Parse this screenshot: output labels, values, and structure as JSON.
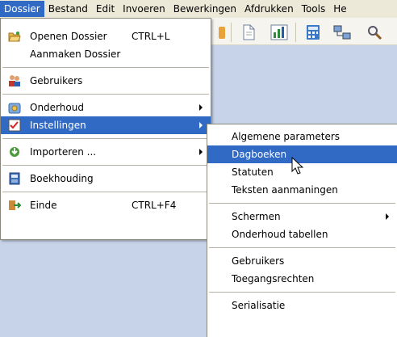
{
  "menubar": {
    "items": [
      "Dossier",
      "Bestand",
      "Edit",
      "Invoeren",
      "Bewerkingen",
      "Afdrukken",
      "Tools",
      "He"
    ]
  },
  "dossier_menu": {
    "items": [
      {
        "label": "Openen Dossier",
        "shortcut": "CTRL+L",
        "icon": "open-folder-icon"
      },
      {
        "label": "Aanmaken Dossier",
        "icon": ""
      },
      {
        "label": "Gebruikers",
        "icon": "users-icon"
      },
      {
        "label": "Onderhoud",
        "icon": "maintenance-icon",
        "submenu": true
      },
      {
        "label": "Instellingen",
        "icon": "settings-checklist-icon",
        "submenu": true,
        "highlighted": true
      },
      {
        "label": "Importeren ...",
        "icon": "import-icon",
        "submenu": true
      },
      {
        "label": "Boekhouding",
        "icon": "accounting-book-icon"
      },
      {
        "label": "Einde",
        "shortcut": "CTRL+F4",
        "icon": "exit-icon"
      }
    ]
  },
  "settings_submenu": {
    "items": [
      {
        "label": "Algemene parameters"
      },
      {
        "label": "Dagboeken",
        "highlighted": true
      },
      {
        "label": "Statuten"
      },
      {
        "label": "Teksten aanmaningen"
      },
      {
        "label": "Schermen",
        "submenu": true
      },
      {
        "label": "Onderhoud tabellen"
      },
      {
        "label": "Gebruikers"
      },
      {
        "label": "Toegangsrechten"
      },
      {
        "label": "Serialisatie"
      }
    ]
  },
  "colors": {
    "highlight": "#316ac5",
    "menubar_bg": "#ece9d8",
    "workspace_bg": "#c7d3e8"
  }
}
